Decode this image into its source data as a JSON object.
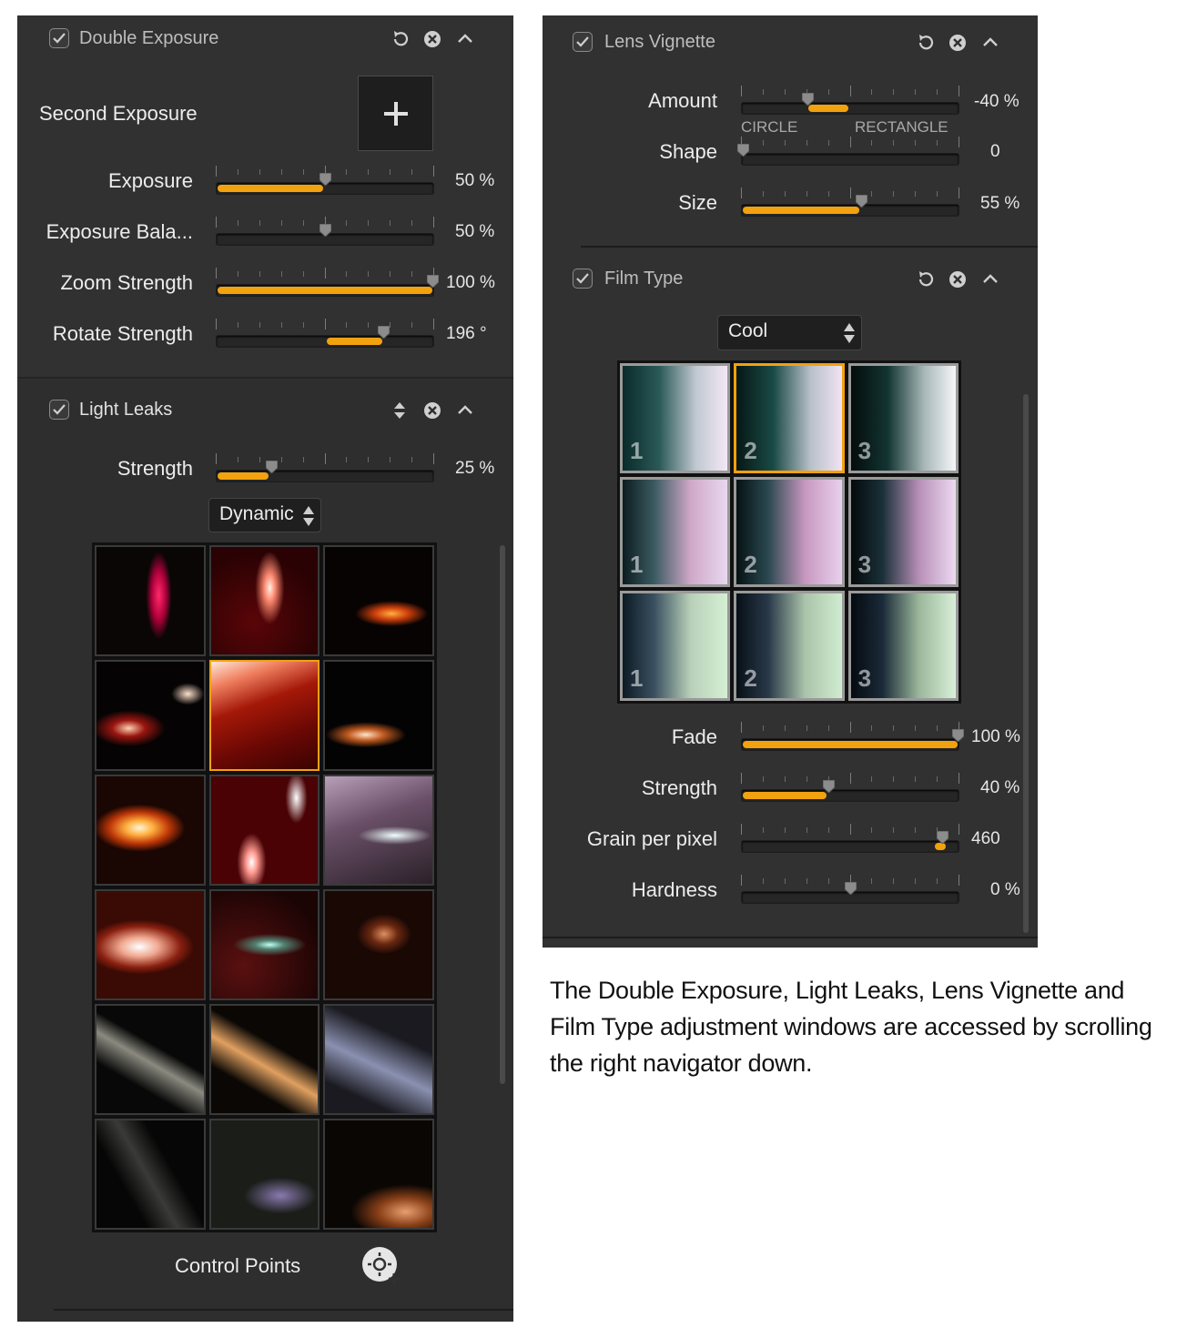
{
  "colors": {
    "panel_bg": "#313131",
    "accent": "#f2a10f",
    "text": "#e6e6e6"
  },
  "double_exposure": {
    "title": "Double Exposure",
    "enabled": true,
    "second_exposure_label": "Second Exposure",
    "add_icon": "plus-icon",
    "sliders": [
      {
        "label": "Exposure",
        "value": "50 %",
        "level": 0.5,
        "fill_from": 0
      },
      {
        "label": "Exposure Bala...",
        "value": "50 %",
        "level": 0.5,
        "fill_from": null
      },
      {
        "label": "Zoom Strength",
        "value": "100 %",
        "level": 1.0,
        "fill_from": 0
      },
      {
        "label": "Rotate Strength",
        "value": "196 °",
        "level": 0.77,
        "fill_from": 0.5
      }
    ]
  },
  "light_leaks": {
    "title": "Light Leaks",
    "enabled": true,
    "sliders": [
      {
        "label": "Strength",
        "value": "25 %",
        "level": 0.25,
        "fill_from": 0
      }
    ],
    "mode_select": "Dynamic",
    "selected_preset": 4,
    "control_points_label": "Control Points",
    "control_points_icon": "add-control-point-icon"
  },
  "lens_vignette": {
    "title": "Lens Vignette",
    "enabled": true,
    "sliders": [
      {
        "label": "Amount",
        "value": "-40 %",
        "level": 0.3,
        "fill_from": 0.5
      },
      {
        "label": "Shape",
        "value": "0",
        "level": 0.0,
        "fill_from": null,
        "left_caption": "CIRCLE",
        "right_caption": "RECTANGLE"
      },
      {
        "label": "Size",
        "value": "55 %",
        "level": 0.55,
        "fill_from": 0
      }
    ]
  },
  "film_type": {
    "title": "Film Type",
    "enabled": true,
    "type_select": "Cool",
    "selected_preset": 1,
    "preset_numbers": [
      "1",
      "2",
      "3",
      "1",
      "2",
      "3",
      "1",
      "2",
      "3"
    ],
    "sliders": [
      {
        "label": "Fade",
        "value": "100 %",
        "level": 1.0,
        "fill_from": 0
      },
      {
        "label": "Strength",
        "value": "40 %",
        "level": 0.4,
        "fill_from": 0
      },
      {
        "label": "Grain per pixel",
        "value": "460",
        "level": 0.93,
        "fill_from": 0.93
      },
      {
        "label": "Hardness",
        "value": "0 %",
        "level": 0.5,
        "fill_from": null
      }
    ]
  },
  "caption": "The Double Exposure, Light Leaks, Lens Vignette and Film Type adjustment windows are accessed by scrolling the right navigator down."
}
